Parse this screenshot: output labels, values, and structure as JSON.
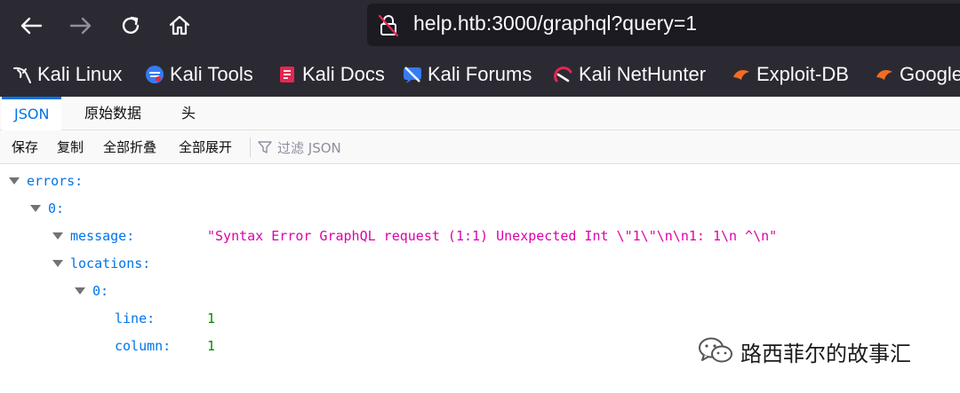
{
  "browser": {
    "url": "help.htb:3000/graphql?query=1",
    "bookmarks": [
      {
        "label": "Kali Linux",
        "icon": "kali-dragon-icon"
      },
      {
        "label": "Kali Tools",
        "icon": "kali-tools-icon"
      },
      {
        "label": "Kali Docs",
        "icon": "kali-docs-icon"
      },
      {
        "label": "Kali Forums",
        "icon": "kali-forums-icon"
      },
      {
        "label": "Kali NetHunter",
        "icon": "kali-nethunter-icon"
      },
      {
        "label": "Exploit-DB",
        "icon": "exploit-db-icon"
      },
      {
        "label": "Google",
        "icon": "google-hacking-db-icon"
      }
    ]
  },
  "viewer": {
    "tabs": [
      "JSON",
      "原始数据",
      "头"
    ],
    "toolbar": {
      "save": "保存",
      "copy": "复制",
      "collapse_all": "全部折叠",
      "expand_all": "全部展开",
      "filter_placeholder": "过滤 JSON"
    },
    "tree": {
      "errors_key": "errors:",
      "index0_key": "0:",
      "message_key": "message:",
      "message_value": "\"Syntax Error GraphQL request (1:1) Unexpected Int \\\"1\\\"\\n\\n1: 1\\n  ^\\n\"",
      "locations_key": "locations:",
      "loc_index0_key": "0:",
      "line_key": "line:",
      "line_value": "1",
      "column_key": "column:",
      "column_value": "1"
    }
  },
  "watermark": {
    "text": "路西菲尔的故事汇",
    "icon": "wechat-icon"
  },
  "colors": {
    "chrome_bg": "#2b2a33",
    "url_bg": "#1c1b22",
    "key": "#0074e8",
    "string": "#dd00a9",
    "number": "#058b00"
  }
}
